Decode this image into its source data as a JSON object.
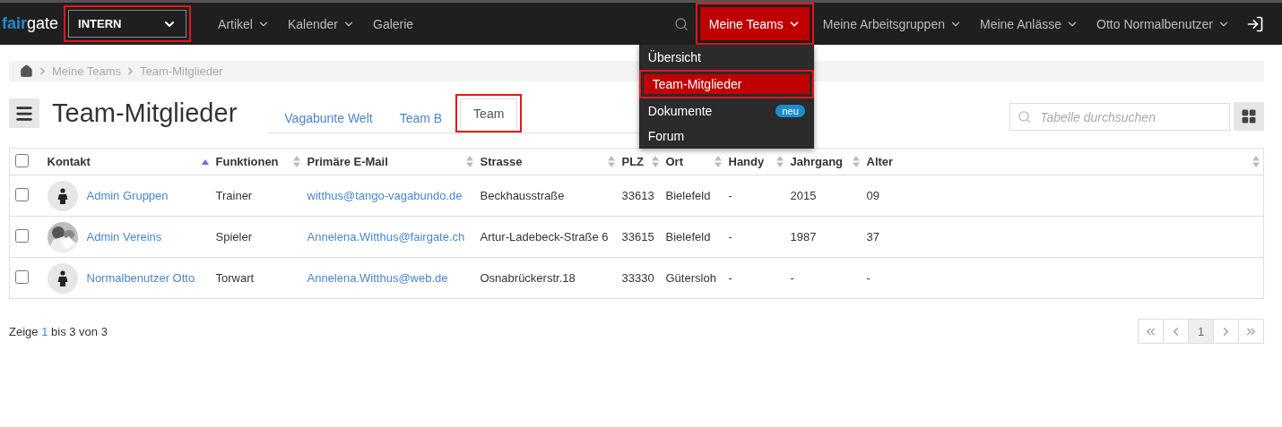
{
  "brand": {
    "part1": "fair",
    "part2": "gate"
  },
  "org_select": {
    "value": "INTERN",
    "highlighted": true
  },
  "nav_left": [
    {
      "label": "Artikel",
      "has_caret": true
    },
    {
      "label": "Kalender",
      "has_caret": true
    },
    {
      "label": "Galerie",
      "has_caret": false
    }
  ],
  "nav_right": [
    {
      "label": "Meine Teams",
      "selected": true,
      "highlighted": true,
      "menu": [
        {
          "label": "Übersicht",
          "selected": false,
          "highlighted": false
        },
        {
          "label": "Team-Mitglieder",
          "selected": true,
          "highlighted": true
        },
        {
          "label": "Dokumente",
          "selected": false,
          "highlighted": false,
          "badge": "neu"
        },
        {
          "label": "Forum",
          "selected": false,
          "highlighted": false
        }
      ]
    },
    {
      "label": "Meine Arbeitsgruppen",
      "selected": false,
      "highlighted": false
    },
    {
      "label": "Meine Anlässe",
      "selected": false,
      "highlighted": false
    },
    {
      "label": "Otto Normalbenutzer",
      "selected": false,
      "highlighted": false
    }
  ],
  "breadcrumb": [
    "Meine Teams",
    "Team-Mitglieder"
  ],
  "page_title": "Team-Mitglieder",
  "tabs": [
    {
      "label": "Vagabunte Welt",
      "selected": false,
      "highlighted": false
    },
    {
      "label": "Team B",
      "selected": false,
      "highlighted": false
    },
    {
      "label": "Team",
      "selected": true,
      "highlighted": true
    }
  ],
  "search": {
    "placeholder": "Tabelle durchsuchen"
  },
  "table": {
    "all_checked": false,
    "columns": [
      {
        "label": "Kontakt",
        "sorted": true
      },
      {
        "label": "Funktionen",
        "sorted": false
      },
      {
        "label": "Primäre E-Mail",
        "sorted": false
      },
      {
        "label": "Strasse",
        "sorted": false
      },
      {
        "label": "PLZ",
        "sorted": false
      },
      {
        "label": "Ort",
        "sorted": false
      },
      {
        "label": "Handy",
        "sorted": false
      },
      {
        "label": "Jahrgang",
        "sorted": false
      },
      {
        "label": "Alter",
        "sorted": false
      }
    ],
    "rows": [
      {
        "checked": false,
        "has_photo": false,
        "cells": [
          "Admin Gruppen",
          "Trainer",
          "witthus@tango-vagabundo.de",
          "Beckhausstraße",
          "33613",
          "Bielefeld",
          "-",
          "2015",
          "09"
        ]
      },
      {
        "checked": false,
        "has_photo": true,
        "cells": [
          "Admin Vereins",
          "Spieler",
          "Annelena.Witthus@fairgate.ch",
          "Artur-Ladebeck-Straße 6",
          "33615",
          "Bielefeld",
          "-",
          "1987",
          "37"
        ]
      },
      {
        "checked": false,
        "has_photo": false,
        "cells": [
          "Normalbenutzer Otto",
          "Torwart",
          "Annelena.Witthus@web.de",
          "Osnabrückerstr.18",
          "33330",
          "Gütersloh",
          "-",
          "-",
          "-"
        ]
      }
    ]
  },
  "footer": {
    "prefix": "Zeige",
    "from": "1",
    "middle": "bis 3 von 3"
  },
  "pagination": [
    {
      "kind": "first",
      "selected": false
    },
    {
      "kind": "prev",
      "selected": false
    },
    {
      "kind": "page",
      "label": "1",
      "selected": true
    },
    {
      "kind": "next",
      "selected": false
    },
    {
      "kind": "last",
      "selected": false
    }
  ]
}
